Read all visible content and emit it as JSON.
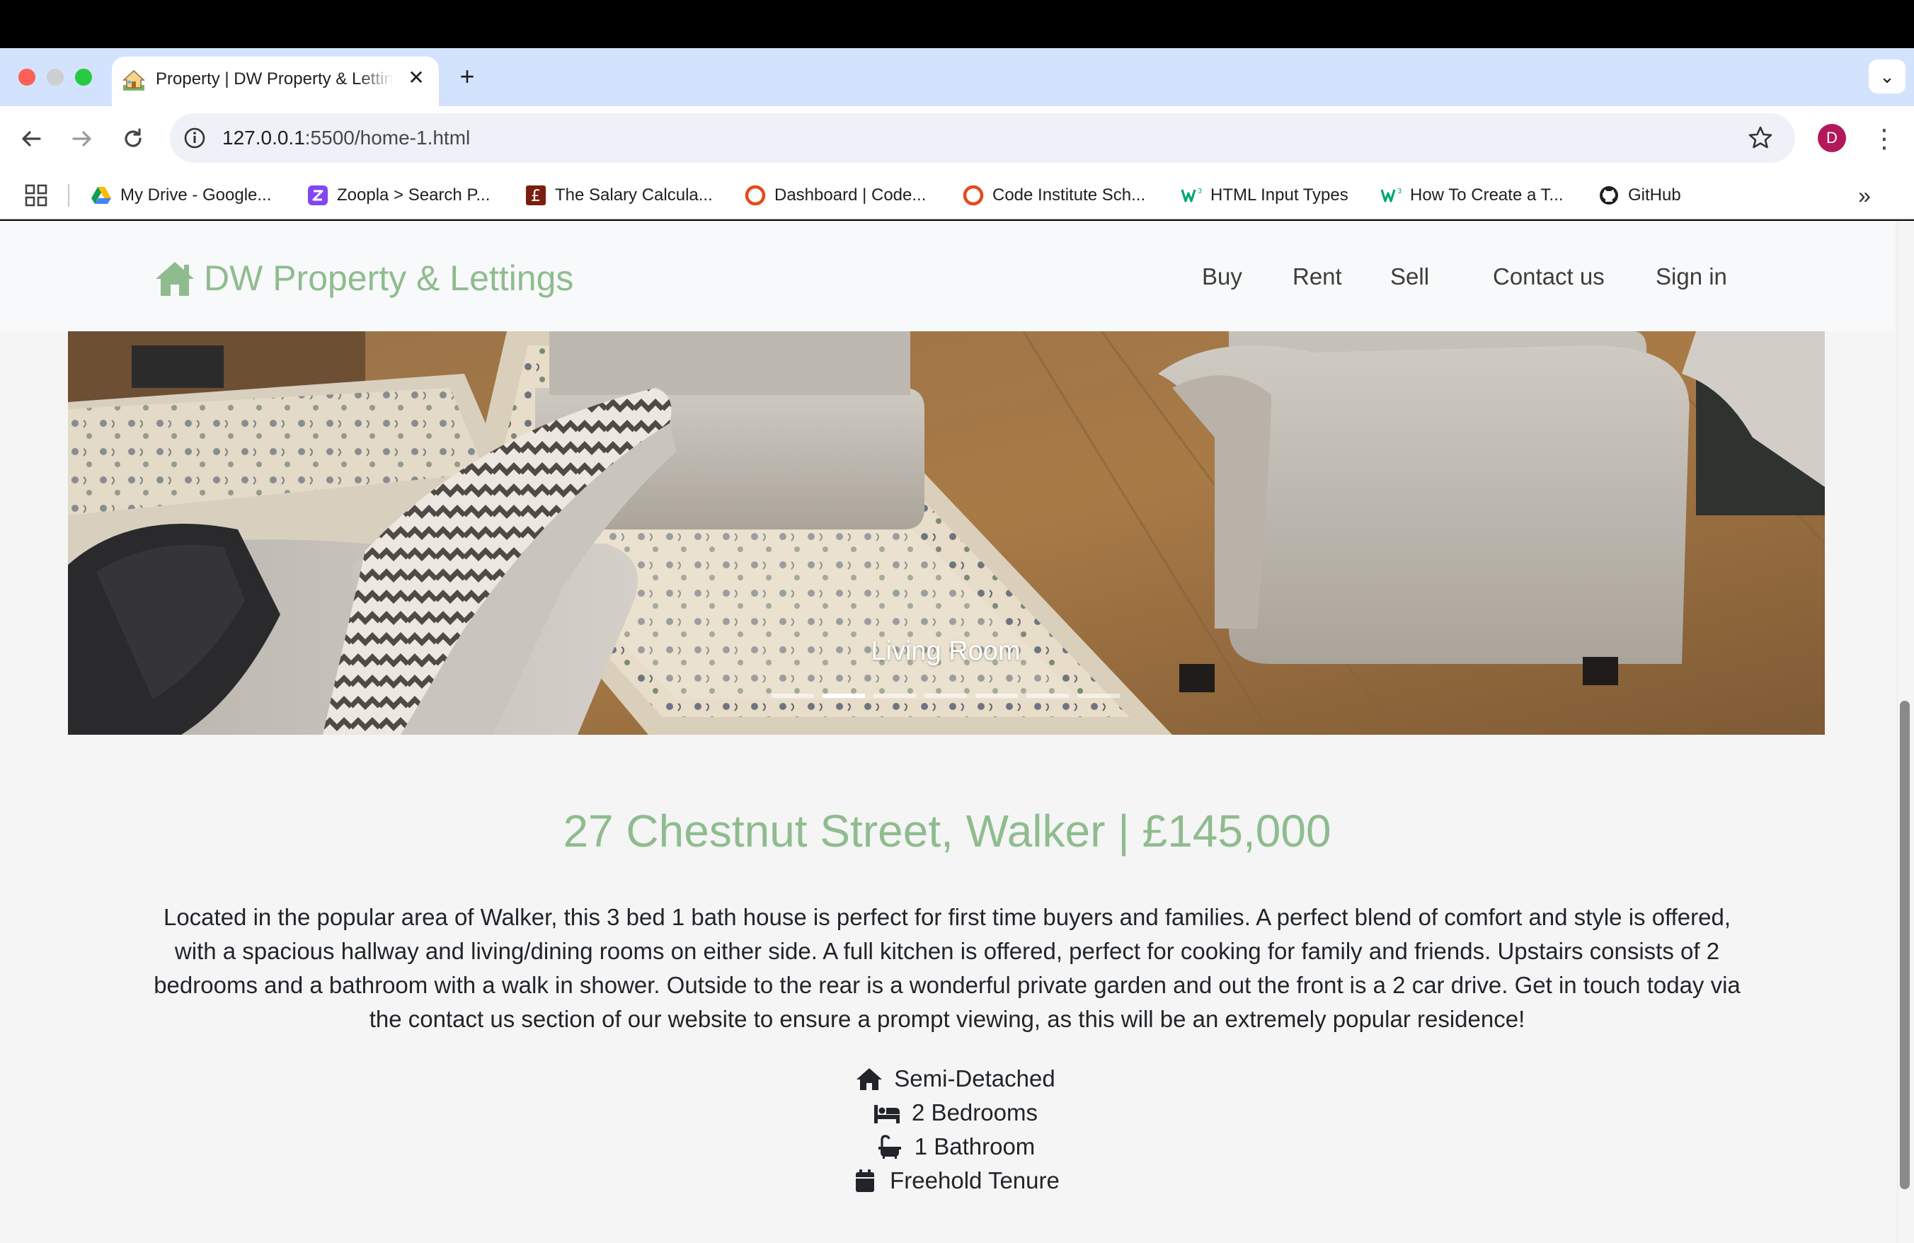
{
  "browser": {
    "tab_title": "Property | DW Property & Lettings",
    "tab_close": "✕",
    "new_tab": "+",
    "tab_menu": "⌄",
    "url_host": "127.0.0.1",
    "url_rest": ":5500/home-1.html",
    "profile_initial": "D",
    "kebab": "⋮",
    "bookmarks": [
      {
        "label": "My Drive - Google...",
        "icon": "google-drive-icon"
      },
      {
        "label": "Zoopla > Search P...",
        "icon": "zoopla-icon"
      },
      {
        "label": "The Salary Calcula...",
        "icon": "pound-icon"
      },
      {
        "label": "Dashboard | Code...",
        "icon": "code-institute-icon"
      },
      {
        "label": "Code Institute Sch...",
        "icon": "code-institute-icon"
      },
      {
        "label": "HTML Input Types",
        "icon": "w3schools-icon"
      },
      {
        "label": "How To Create a T...",
        "icon": "w3schools-icon"
      },
      {
        "label": "GitHub",
        "icon": "github-icon"
      }
    ],
    "bookmarks_more": "»"
  },
  "site": {
    "brand": "DW Property & Lettings",
    "nav": [
      "Buy",
      "Rent",
      "Sell",
      "Contact us",
      "Sign in"
    ],
    "carousel": {
      "caption": "Living Room",
      "slide_count": 7,
      "active_index": 1
    },
    "property": {
      "title": "27 Chestnut Street, Walker | £145,000",
      "description": "Located in the popular area of Walker, this 3 bed 1 bath house is perfect for first time buyers and families. A perfect blend of comfort and style is offered, with a spacious hallway and living/dining rooms on either side. A full kitchen is offered, perfect for cooking for family and friends. Upstairs consists of 2 bedrooms and a bathroom with a walk in shower. Outside to the rear is a wonderful private garden and out the front is a 2 car drive. Get in touch today via the contact us section of our website to ensure a prompt viewing, as this will be an extremely popular residence!",
      "features": [
        {
          "label": "Semi-Detached",
          "icon": "house-icon"
        },
        {
          "label": "2 Bedrooms",
          "icon": "bed-icon"
        },
        {
          "label": "1 Bathroom",
          "icon": "bath-icon"
        },
        {
          "label": "Freehold Tenure",
          "icon": "calendar-icon"
        }
      ]
    }
  },
  "colors": {
    "brand_green": "#8fbc8f",
    "tab_strip": "#d3e3fd",
    "page_bg": "#f5f5f5",
    "nav_bg": "#f8f9fa"
  }
}
